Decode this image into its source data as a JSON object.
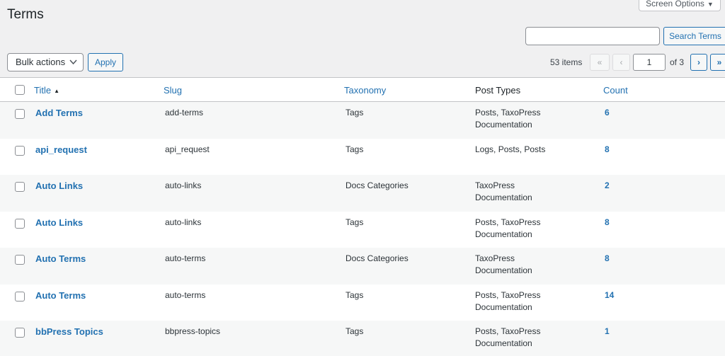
{
  "header": {
    "title": "Terms",
    "screen_options": "Screen Options"
  },
  "search": {
    "placeholder": "",
    "button_label": "Search Terms"
  },
  "toolbar": {
    "bulk_actions": "Bulk actions",
    "apply_label": "Apply",
    "items_count": "53 items",
    "first_page": "«",
    "prev_page": "‹",
    "current_page": "1",
    "of_pages": "of 3",
    "next_page": "›",
    "last_page": "»"
  },
  "table": {
    "columns": {
      "title": "Title",
      "slug": "Slug",
      "taxonomy": "Taxonomy",
      "post_types": "Post Types",
      "count": "Count"
    },
    "rows": [
      {
        "title": "Add Terms",
        "slug": "add-terms",
        "taxonomy": "Tags",
        "post_types": "Posts, TaxoPress Documentation",
        "count": "6"
      },
      {
        "title": "api_request",
        "slug": "api_request",
        "taxonomy": "Tags",
        "post_types": "Logs, Posts, Posts",
        "count": "8"
      },
      {
        "title": "Auto Links",
        "slug": "auto-links",
        "taxonomy": "Docs Categories",
        "post_types": "TaxoPress Documentation",
        "count": "2"
      },
      {
        "title": "Auto Links",
        "slug": "auto-links",
        "taxonomy": "Tags",
        "post_types": "Posts, TaxoPress Documentation",
        "count": "8"
      },
      {
        "title": "Auto Terms",
        "slug": "auto-terms",
        "taxonomy": "Docs Categories",
        "post_types": "TaxoPress Documentation",
        "count": "8"
      },
      {
        "title": "Auto Terms",
        "slug": "auto-terms",
        "taxonomy": "Tags",
        "post_types": "Posts, TaxoPress Documentation",
        "count": "14"
      },
      {
        "title": "bbPress Topics",
        "slug": "bbpress-topics",
        "taxonomy": "Tags",
        "post_types": "Posts, TaxoPress Documentation",
        "count": "1"
      }
    ]
  }
}
